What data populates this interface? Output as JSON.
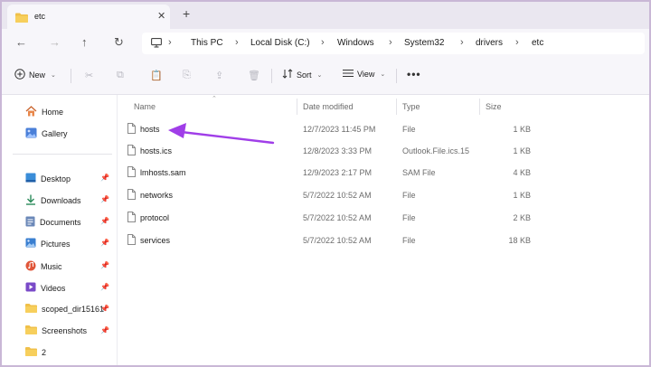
{
  "tab": {
    "title": "etc",
    "close": "✕",
    "add": "+"
  },
  "nav": {
    "back": "←",
    "forward": "→",
    "up": "↑",
    "refresh": "↻"
  },
  "breadcrumbs": [
    "This PC",
    "Local Disk (C:)",
    "Windows",
    "System32",
    "drivers",
    "etc"
  ],
  "toolbar": {
    "new_label": "New",
    "sort_label": "Sort",
    "view_label": "View",
    "more_label": "•••"
  },
  "sidebar": {
    "top_items": [
      {
        "label": "Home",
        "icon": "home-icon"
      },
      {
        "label": "Gallery",
        "icon": "gallery-icon"
      }
    ],
    "quick_access": [
      {
        "label": "Desktop",
        "icon": "desktop-icon"
      },
      {
        "label": "Downloads",
        "icon": "download-icon"
      },
      {
        "label": "Documents",
        "icon": "documents-icon"
      },
      {
        "label": "Pictures",
        "icon": "pictures-icon"
      },
      {
        "label": "Music",
        "icon": "music-icon"
      },
      {
        "label": "Videos",
        "icon": "videos-icon"
      },
      {
        "label": "scoped_dir15161",
        "icon": "folder-icon"
      },
      {
        "label": "Screenshots",
        "icon": "folder-icon"
      },
      {
        "label": "2",
        "icon": "folder-icon"
      }
    ]
  },
  "columns": {
    "name": "Name",
    "date": "Date modified",
    "type": "Type",
    "size": "Size"
  },
  "files": [
    {
      "name": "hosts",
      "date": "12/7/2023 11:45 PM",
      "type": "File",
      "size": "1 KB"
    },
    {
      "name": "hosts.ics",
      "date": "12/8/2023 3:33 PM",
      "type": "Outlook.File.ics.15",
      "size": "1 KB"
    },
    {
      "name": "lmhosts.sam",
      "date": "12/9/2023 2:17 PM",
      "type": "SAM File",
      "size": "4 KB"
    },
    {
      "name": "networks",
      "date": "5/7/2022 10:52 AM",
      "type": "File",
      "size": "1 KB"
    },
    {
      "name": "protocol",
      "date": "5/7/2022 10:52 AM",
      "type": "File",
      "size": "2 KB"
    },
    {
      "name": "services",
      "date": "5/7/2022 10:52 AM",
      "type": "File",
      "size": "18 KB"
    }
  ],
  "colors": {
    "annotation_arrow": "#a03ee8",
    "folder": "#f0c04a",
    "accent": "#4a7fd8"
  }
}
